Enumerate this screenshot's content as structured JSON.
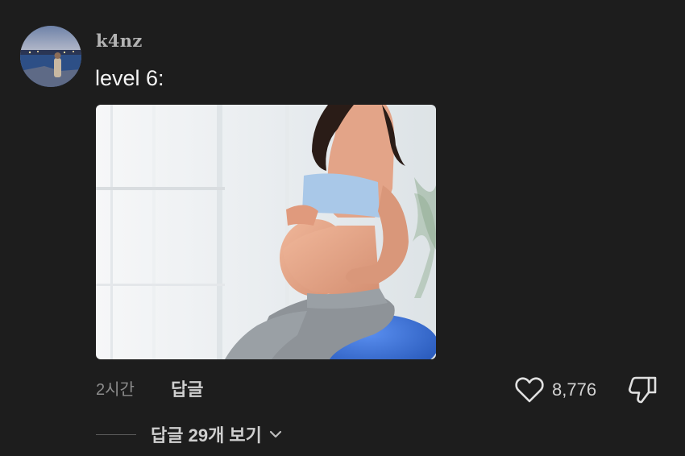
{
  "comment": {
    "username": "k4nz",
    "text": "level 6:",
    "image": {
      "subject": "pregnant-woman-on-exercise-ball",
      "colors": {
        "window": "#f1f3f6",
        "top": "#a9c8e8",
        "pants": "#8e9398",
        "ball": "#2c63c9",
        "skin": "#e8a78b",
        "hair": "#2a1c17"
      }
    },
    "timestamp": "2시간",
    "reply_label": "답글",
    "likes": "8,776",
    "view_replies_label": "답글 29개 보기"
  },
  "icons": {
    "like": "heart-outline-icon",
    "dislike": "thumbs-down-outline-icon",
    "chevron": "chevron-down-icon"
  },
  "colors": {
    "background": "#1d1d1d",
    "text_primary": "#f4f4f4",
    "text_secondary": "#8c8c8c"
  }
}
